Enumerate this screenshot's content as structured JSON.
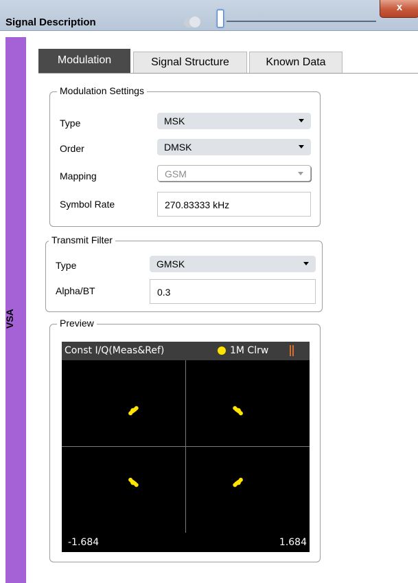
{
  "window": {
    "title": "Signal Description",
    "close_label": "x"
  },
  "sidebar": {
    "label": "VSA"
  },
  "tabs": [
    {
      "label": "Modulation",
      "active": true
    },
    {
      "label": "Signal Structure",
      "active": false
    },
    {
      "label": "Known Data",
      "active": false
    }
  ],
  "modulation_settings": {
    "legend": "Modulation Settings",
    "type_label": "Type",
    "type_value": "MSK",
    "order_label": "Order",
    "order_value": "DMSK",
    "mapping_label": "Mapping",
    "mapping_value": "GSM",
    "symbol_rate_label": "Symbol Rate",
    "symbol_rate_value": "270.83333 kHz"
  },
  "transmit_filter": {
    "legend": "Transmit Filter",
    "type_label": "Type",
    "type_value": "GMSK",
    "alpha_label": "Alpha/BT",
    "alpha_value": "0.3"
  },
  "preview": {
    "legend": "Preview",
    "title": "Const I/Q(Meas&Ref)",
    "trace_label": "1M Clrw",
    "x_min": "-1.684",
    "x_max": "1.684"
  },
  "colors": {
    "accent": "#a561d6",
    "trace": "#ffe400"
  },
  "chart_data": {
    "type": "scatter",
    "title": "Const I/Q(Meas&Ref)",
    "xlim": [
      -1.684,
      1.684
    ],
    "ylim": [
      -1.684,
      1.684
    ],
    "series": [
      {
        "name": "1M Clrw",
        "points": [
          [
            -0.69,
            0.72
          ],
          [
            -0.71,
            0.7
          ],
          [
            -0.73,
            0.68
          ],
          [
            -0.75,
            0.65
          ],
          [
            -0.67,
            0.75
          ],
          [
            -0.72,
            0.71
          ],
          [
            0.69,
            0.72
          ],
          [
            0.71,
            0.7
          ],
          [
            0.73,
            0.68
          ],
          [
            0.75,
            0.65
          ],
          [
            0.67,
            0.75
          ],
          [
            0.72,
            0.71
          ],
          [
            -0.69,
            -0.72
          ],
          [
            -0.71,
            -0.7
          ],
          [
            -0.73,
            -0.68
          ],
          [
            -0.75,
            -0.65
          ],
          [
            -0.67,
            -0.75
          ],
          [
            -0.72,
            -0.71
          ],
          [
            0.69,
            -0.72
          ],
          [
            0.71,
            -0.7
          ],
          [
            0.73,
            -0.68
          ],
          [
            0.75,
            -0.65
          ],
          [
            0.67,
            -0.75
          ],
          [
            0.72,
            -0.71
          ]
        ]
      }
    ]
  }
}
